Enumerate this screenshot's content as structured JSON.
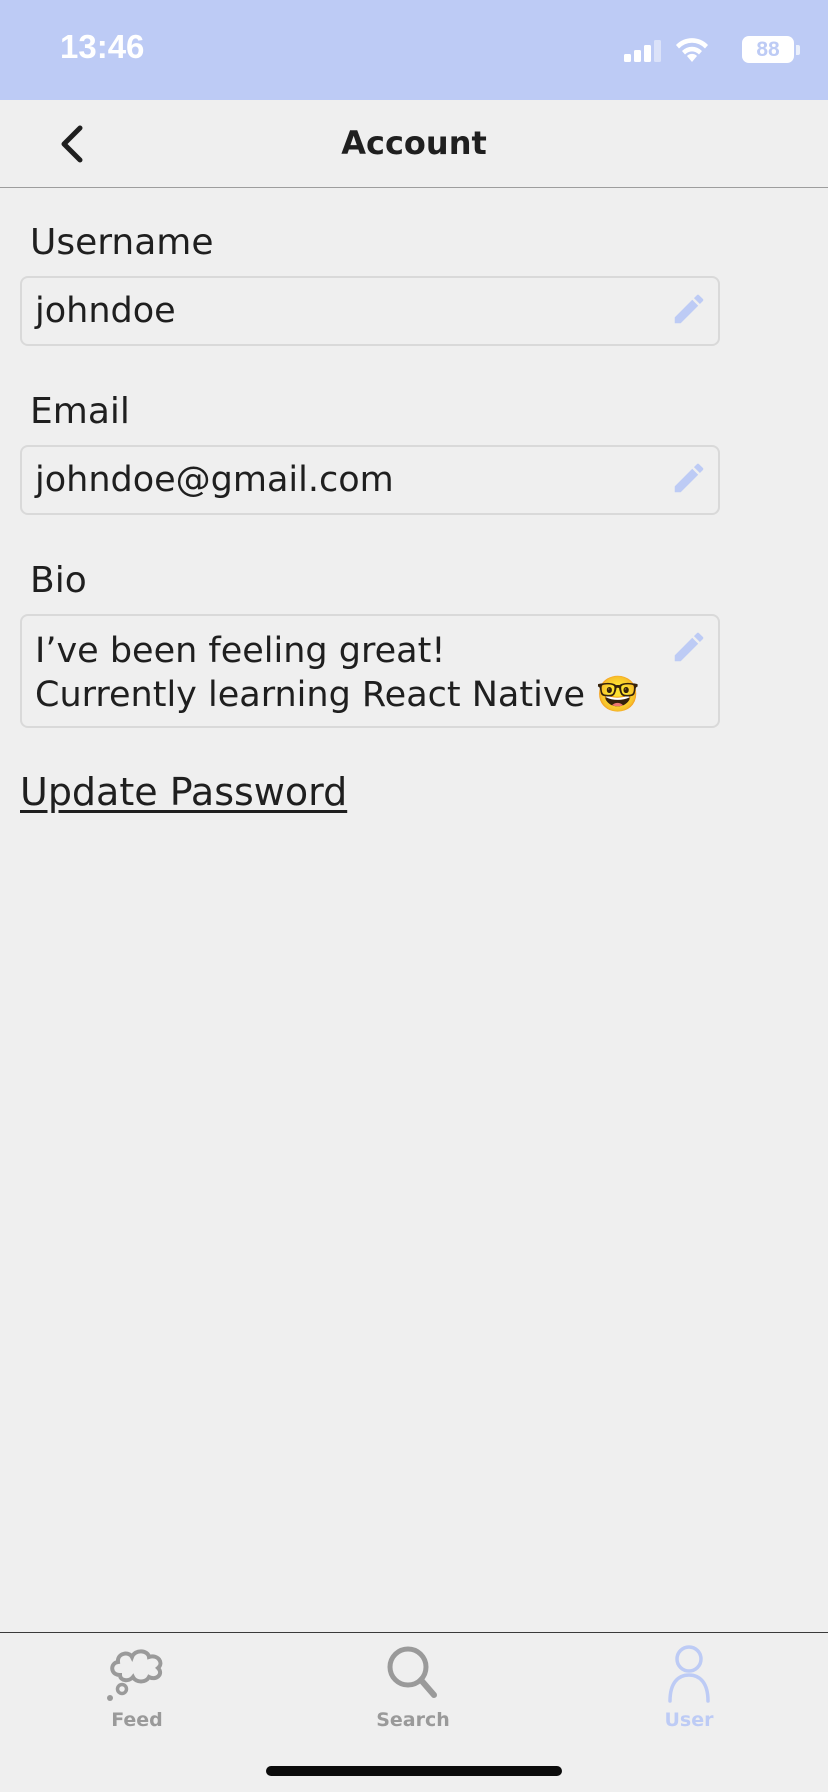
{
  "status_bar": {
    "time": "13:46",
    "battery": "88",
    "background_color": "#bdcbf5"
  },
  "header": {
    "title": "Account",
    "back_icon": "chevron-left-icon"
  },
  "form": {
    "username": {
      "label": "Username",
      "value": "johndoe",
      "edit_icon": "pencil-icon"
    },
    "email": {
      "label": "Email",
      "value": "johndoe@gmail.com",
      "edit_icon": "pencil-icon"
    },
    "bio": {
      "label": "Bio",
      "value": "I’ve been feeling great!\nCurrently learning React Native 🤓",
      "edit_icon": "pencil-icon"
    }
  },
  "update_password": {
    "label": "Update Password"
  },
  "tab_bar": {
    "tabs": [
      {
        "label": "Feed",
        "icon": "thought-cloud-icon",
        "active": false
      },
      {
        "label": "Search",
        "icon": "search-icon",
        "active": false
      },
      {
        "label": "User",
        "icon": "user-icon",
        "active": true
      }
    ],
    "active_color": "#bdcbf5",
    "inactive_color": "#9a9a9a"
  }
}
